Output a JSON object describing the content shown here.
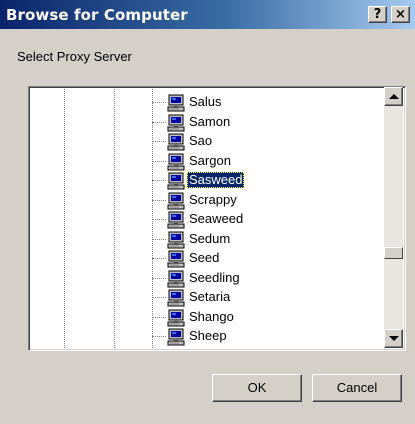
{
  "window": {
    "title": "Browse for Computer",
    "help_glyph": "?",
    "close_glyph": "×"
  },
  "description": "Select Proxy Server",
  "tree": {
    "nodes": [
      {
        "label": "Salus",
        "icon": "computer-icon"
      },
      {
        "label": "Samon",
        "icon": "computer-icon"
      },
      {
        "label": "Sao",
        "icon": "computer-icon"
      },
      {
        "label": "Sargon",
        "icon": "computer-icon"
      },
      {
        "label": "Sasweed",
        "icon": "computer-icon",
        "selected": true
      },
      {
        "label": "Scrappy",
        "icon": "computer-icon"
      },
      {
        "label": "Seaweed",
        "icon": "computer-icon"
      },
      {
        "label": "Sedum",
        "icon": "computer-icon"
      },
      {
        "label": "Seed",
        "icon": "computer-icon"
      },
      {
        "label": "Seedling",
        "icon": "computer-icon"
      },
      {
        "label": "Setaria",
        "icon": "computer-icon"
      },
      {
        "label": "Shango",
        "icon": "computer-icon"
      },
      {
        "label": "Sheep",
        "icon": "computer-icon"
      }
    ]
  },
  "buttons": {
    "ok": "OK",
    "cancel": "Cancel"
  },
  "colors": {
    "titlebar_start": "#0a246a",
    "titlebar_end": "#a6caf0",
    "selection": "#0a246a",
    "face": "#d4d0c8"
  }
}
